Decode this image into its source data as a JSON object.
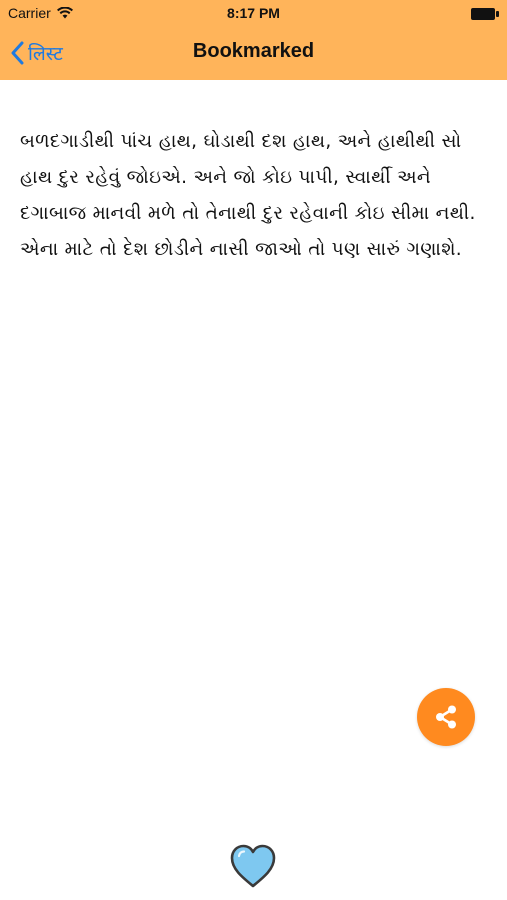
{
  "status_bar": {
    "carrier": "Carrier",
    "time": "8:17 PM",
    "icons": [
      "wifi-icon",
      "battery-icon"
    ]
  },
  "nav": {
    "back_label": "लिस्ट",
    "title": "Bookmarked",
    "back_icon": "chevron-left-icon"
  },
  "content": {
    "text": "બળદગાડીથી પાંચ હાથ, ઘોડાથી દશ હાથ, અને હાથીથી સો હાથ દુર રહેવું જોઇએ. અને જો કોઇ પાપી, સ્વાર્થી અને દગાબાજ માનવી મળે તો તેનાથી દુર રહેવાની કોઇ સીમા નથી. એના માટે તો દેશ છોડીને નાસી જાઓ તો પણ સારું ગણાશે."
  },
  "actions": {
    "share_icon": "share-icon",
    "heart_icon": "heart-icon"
  },
  "colors": {
    "header_bg": "#ffb45a",
    "accent_blue": "#1f7ae0",
    "share_bg": "#ff8a1f",
    "heart_fill": "#7ec8f0"
  }
}
